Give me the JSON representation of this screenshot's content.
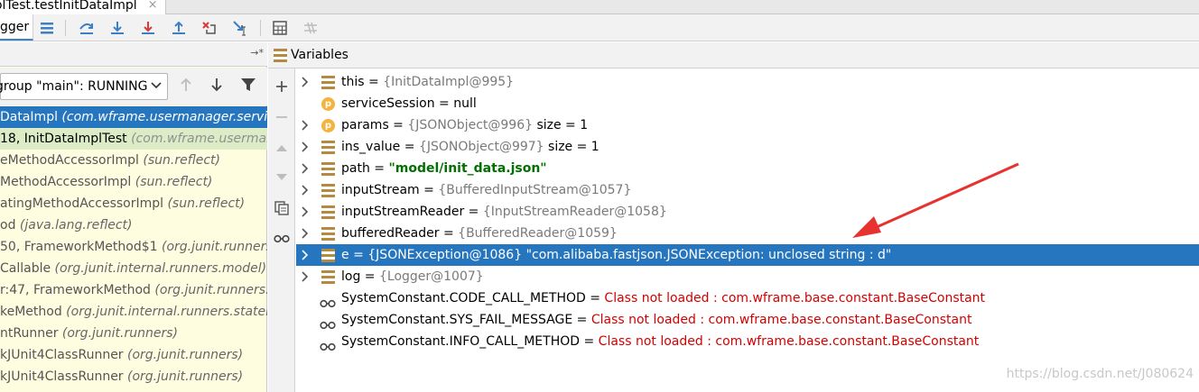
{
  "tab": {
    "title": "mplTest.testInitDataImpl",
    "close": "×"
  },
  "toolbar": {
    "debugger_label": "gger"
  },
  "left": {
    "pin_label": "→*",
    "thread_select": "group \"main\": RUNNING",
    "frames": [
      {
        "name": "DataImpl",
        "pkg": "(com.wframe.usermanager.services."
      },
      {
        "name": "18, InitDataImplTest",
        "pkg": "(com.wframe.usermanag"
      },
      {
        "name": "eMethodAccessorImpl",
        "pkg": "(sun.reflect)"
      },
      {
        "name": "MethodAccessorImpl",
        "pkg": "(sun.reflect)"
      },
      {
        "name": "atingMethodAccessorImpl",
        "pkg": "(sun.reflect)"
      },
      {
        "name": "od",
        "pkg": "(java.lang.reflect)"
      },
      {
        "name": "50, FrameworkMethod$1",
        "pkg": "(org.junit.runners.m"
      },
      {
        "name": "Callable",
        "pkg": "(org.junit.internal.runners.model)"
      },
      {
        "name": "r:47, FrameworkMethod",
        "pkg": "(org.junit.runners.m"
      },
      {
        "name": "keMethod",
        "pkg": "(org.junit.internal.runners.stateme"
      },
      {
        "name": "ntRunner",
        "pkg": "(org.junit.runners)"
      },
      {
        "name": "kJUnit4ClassRunner",
        "pkg": "(org.junit.runners)"
      },
      {
        "name": "kJUnit4ClassRunner",
        "pkg": "(org.junit.runners)"
      }
    ]
  },
  "variables": {
    "title": "Variables",
    "rows": [
      {
        "name": "this",
        "eq": " = ",
        "ref": "{InitDataImpl@995}",
        "extra": ""
      },
      {
        "name": "serviceSession",
        "eq": " = ",
        "ref": "",
        "extra": "null"
      },
      {
        "name": "params",
        "eq": " = ",
        "ref": "{JSONObject@996}",
        "extra": "  size = 1"
      },
      {
        "name": "ins_value",
        "eq": " = ",
        "ref": "{JSONObject@997}",
        "extra": "  size = 1"
      },
      {
        "name": "path",
        "eq": " = ",
        "ref": "",
        "extra": "\"model/init_data.json\""
      },
      {
        "name": "inputStream",
        "eq": " = ",
        "ref": "{BufferedInputStream@1057}",
        "extra": ""
      },
      {
        "name": "inputStreamReader",
        "eq": " = ",
        "ref": "{InputStreamReader@1058}",
        "extra": ""
      },
      {
        "name": "bufferedReader",
        "eq": " = ",
        "ref": "{BufferedReader@1059}",
        "extra": ""
      },
      {
        "name": "e",
        "eq": " = ",
        "ref": "{JSONException@1086}",
        "extra": " \"com.alibaba.fastjson.JSONException: unclosed string : d\""
      },
      {
        "name": "log",
        "eq": " = ",
        "ref": "{Logger@1007}",
        "extra": ""
      },
      {
        "name": "SystemConstant.CODE_CALL_METHOD",
        "eq": " = ",
        "ref": "",
        "extra": "Class not loaded : com.wframe.base.constant.BaseConstant"
      },
      {
        "name": "SystemConstant.SYS_FAIL_MESSAGE",
        "eq": " = ",
        "ref": "",
        "extra": "Class not loaded : com.wframe.base.constant.BaseConstant"
      },
      {
        "name": "SystemConstant.INFO_CALL_METHOD",
        "eq": " = ",
        "ref": "",
        "extra": "Class not loaded : com.wframe.base.constant.BaseConstant"
      }
    ]
  },
  "watermark": "https://blog.csdn.net/J080624",
  "colors": {
    "selection": "#2675bf",
    "annotation_arrow": "#e8322f",
    "string_value": "#007000",
    "error_value": "#d40000"
  }
}
